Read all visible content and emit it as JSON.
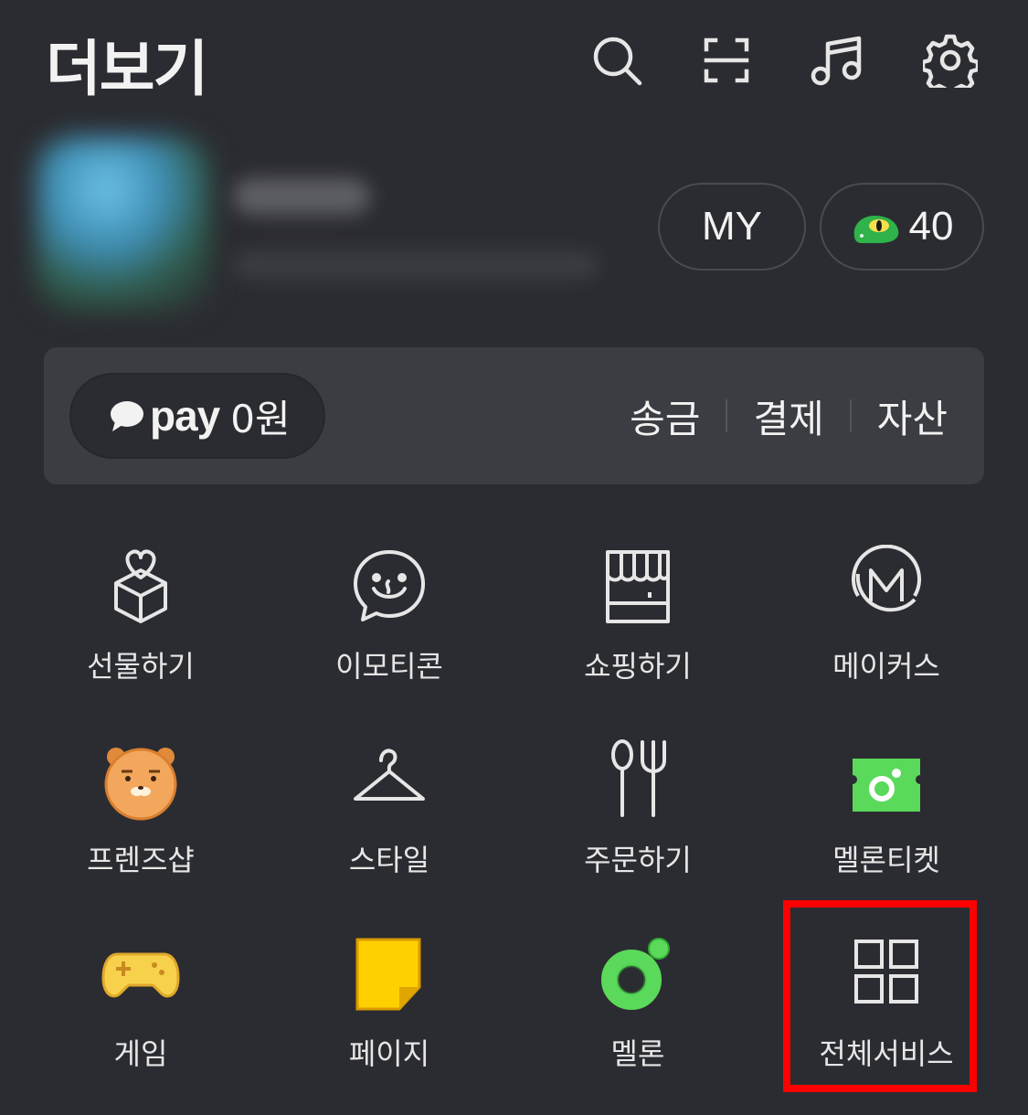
{
  "header": {
    "title": "더보기",
    "icons": [
      "search-icon",
      "scan-icon",
      "music-icon",
      "settings-icon"
    ]
  },
  "profile": {
    "my_label": "MY",
    "points": "40"
  },
  "pay": {
    "brand": "pay",
    "balance": "0원",
    "actions": [
      "송금",
      "결제",
      "자산"
    ]
  },
  "services": [
    {
      "label": "선물하기",
      "icon": "gift-icon"
    },
    {
      "label": "이모티콘",
      "icon": "emoticon-icon"
    },
    {
      "label": "쇼핑하기",
      "icon": "shop-icon"
    },
    {
      "label": "메이커스",
      "icon": "makers-icon"
    },
    {
      "label": "프렌즈샵",
      "icon": "friends-ryan-icon"
    },
    {
      "label": "스타일",
      "icon": "hanger-icon"
    },
    {
      "label": "주문하기",
      "icon": "fork-spoon-icon"
    },
    {
      "label": "멜론티켓",
      "icon": "melon-ticket-icon"
    },
    {
      "label": "게임",
      "icon": "gamepad-icon"
    },
    {
      "label": "페이지",
      "icon": "page-icon"
    },
    {
      "label": "멜론",
      "icon": "melon-icon"
    },
    {
      "label": "전체서비스",
      "icon": "all-services-icon"
    }
  ],
  "colors": {
    "background": "#2b2c31",
    "card": "#3c3d42",
    "highlight": "#ff0000",
    "melon_green": "#5ad95a",
    "game_yellow": "#f7d14c",
    "ryan_orange": "#f2a75c"
  }
}
